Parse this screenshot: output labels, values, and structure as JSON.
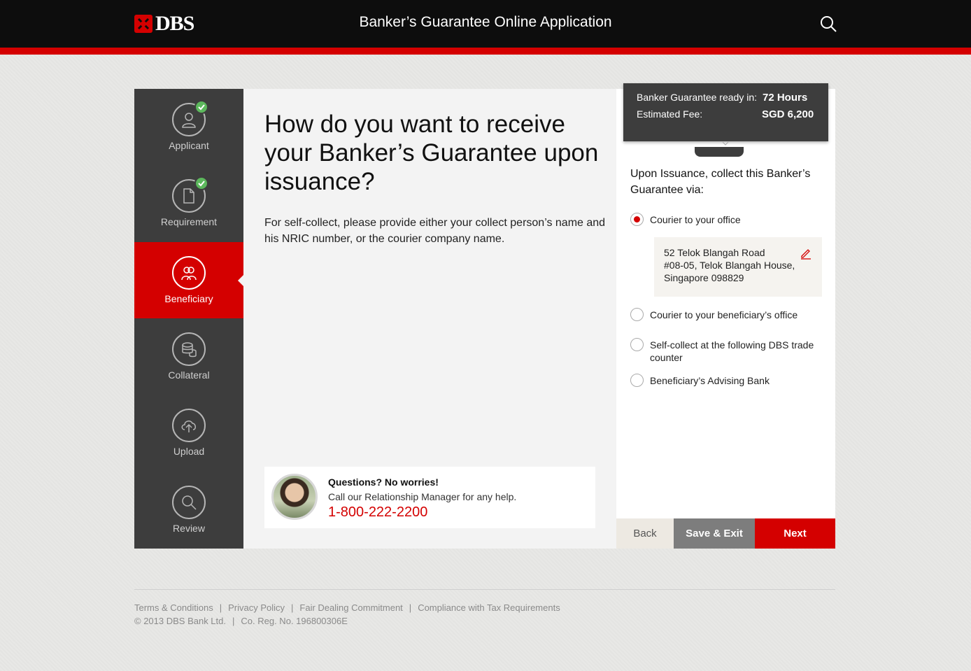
{
  "header": {
    "logo_text": "DBS",
    "title": "Banker’s Guarantee Online Application"
  },
  "sidebar": {
    "items": [
      {
        "label": "Applicant",
        "completed": true,
        "icon": "person-icon"
      },
      {
        "label": "Requirement",
        "completed": true,
        "icon": "document-icon"
      },
      {
        "label": "Beneficiary",
        "active": true,
        "icon": "group-icon"
      },
      {
        "label": "Collateral",
        "icon": "coins-icon"
      },
      {
        "label": "Upload",
        "icon": "cloud-upload-icon"
      },
      {
        "label": "Review",
        "icon": "magnifier-icon"
      }
    ]
  },
  "main": {
    "question": "How do you want to receive your Banker’s Guarantee upon issuance?",
    "instruction": "For self-collect, please provide either your collect person’s name and his NRIC number, or the courier company name.",
    "help": {
      "title": "Questions? No worries!",
      "subtitle": "Call our Relationship Manager for any help.",
      "phone": "1-800-222-2200"
    }
  },
  "summary": {
    "ready_label": "Banker Guarantee ready in:",
    "ready_value": "72 Hours",
    "fee_label": "Estimated Fee:",
    "fee_value": "SGD 6,200"
  },
  "collect": {
    "title": "Upon Issuance, collect this Banker’s Guarantee via:",
    "options": [
      {
        "label": "Courier to your office",
        "selected": true
      },
      {
        "label": "Courier to your beneficiary’s office",
        "selected": false
      },
      {
        "label": "Self-collect at the following DBS trade counter",
        "selected": false
      },
      {
        "label": "Beneficiary’s Advising Bank",
        "selected": false
      }
    ],
    "address": {
      "line1": "52 Telok Blangah Road",
      "line2": "#08-05, Telok Blangah House,",
      "line3": "Singapore 098829"
    }
  },
  "actions": {
    "back": "Back",
    "save_exit": "Save & Exit",
    "next": "Next"
  },
  "footer": {
    "links": [
      "Terms & Conditions",
      "Privacy Policy",
      "Fair Dealing Commitment",
      "Compliance with Tax Requirements"
    ],
    "copyright": "© 2013 DBS Bank Ltd.",
    "reg_no": "Co. Reg. No. 196800306E"
  },
  "colors": {
    "brand_red": "#d40000",
    "sidebar_bg": "#3d3d3d",
    "success_green": "#5cb85c"
  }
}
